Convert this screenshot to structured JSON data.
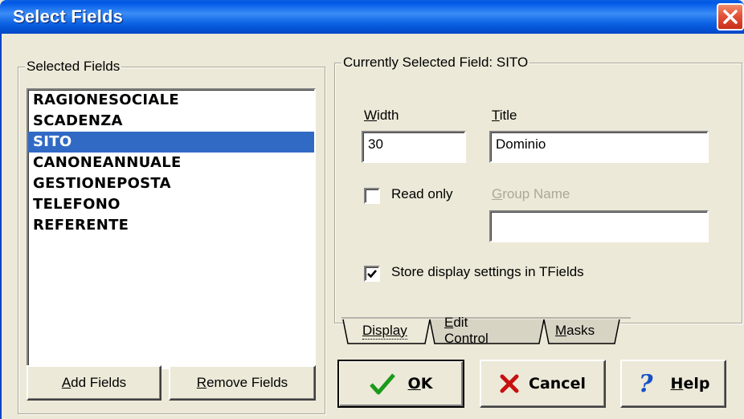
{
  "window": {
    "title": "Select Fields"
  },
  "selected_fields": {
    "group_label": "Selected Fields",
    "items": [
      "RAGIONESOCIALE",
      "SCADENZA",
      "SITO",
      "CANONEANNUALE",
      "GESTIONEPOSTA",
      "TELEFONO",
      "REFERENTE"
    ],
    "selected_index": 2
  },
  "current_field": {
    "group_label": "Currently Selected Field: SITO",
    "width_label_u": "W",
    "width_label_rest": "idth",
    "width_value": "30",
    "title_label_u": "T",
    "title_label_rest": "itle",
    "title_value": "Dominio",
    "read_only_label": "Read only",
    "read_only_checked": false,
    "group_name_label_u": "G",
    "group_name_label_rest": "roup Name",
    "group_name_value": "",
    "store_label": "Store display settings in TFields",
    "store_checked": true
  },
  "tabs": {
    "display": {
      "u": "D",
      "rest": "isplay"
    },
    "edit_control": {
      "u": "E",
      "rest": "dit Control"
    },
    "masks": {
      "u": "M",
      "rest": "asks"
    }
  },
  "buttons": {
    "add_fields": {
      "u": "A",
      "rest": "dd Fields"
    },
    "remove_fields": {
      "u": "R",
      "rest": "emove Fields"
    },
    "ok": {
      "u": "O",
      "rest": "K"
    },
    "cancel": {
      "label": "Cancel"
    },
    "help": {
      "u": "H",
      "rest": "elp"
    }
  },
  "colors": {
    "titlebar": "#0058e6",
    "selection": "#316ac5",
    "ok_check": "#1a9a1a",
    "cancel_x": "#c81010",
    "help_q": "#1450c8"
  },
  "icons": [
    "close-icon",
    "checkmark-icon",
    "cancel-x-icon",
    "help-question-icon"
  ]
}
